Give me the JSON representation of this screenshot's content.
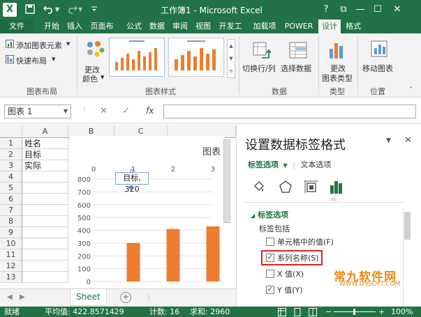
{
  "titlebar": {
    "title": "工作簿1 - Microsoft Excel",
    "app_icon": "X",
    "help": "?",
    "restore": "⧉",
    "minimize": "—",
    "maximize": "☐",
    "close": "✕"
  },
  "tabs": [
    "文件",
    "开始",
    "插入",
    "页面布",
    "公式",
    "数据",
    "审阅",
    "视图",
    "开发工",
    "加载项",
    "POWER",
    "设计",
    "格式"
  ],
  "ribbon": {
    "add_element": "添加图表元素",
    "quick_layout": "快速布局",
    "change_color_1": "更改",
    "change_color_2": "颜色",
    "group_layout": "图表布局",
    "group_styles": "图表样式",
    "switch_row_col": "切换行/列",
    "select_data": "选择数据",
    "group_data": "数据",
    "change_type_1": "更改",
    "change_type_2": "图表类型",
    "group_type": "类型",
    "move_chart": "移动图表",
    "group_location": "位置"
  },
  "formula_bar": {
    "name_box": "图表 1",
    "cancel": "✕",
    "enter": "✓",
    "fx": "fx"
  },
  "grid": {
    "columns": [
      "A",
      "B",
      "C"
    ],
    "rows": [
      "1",
      "2",
      "3",
      "4",
      "5",
      "6",
      "7",
      "8",
      "9",
      "10",
      "11",
      "12",
      "13"
    ],
    "cells": [
      "姓名",
      "目标",
      "实际"
    ]
  },
  "chart_data": {
    "type": "bar",
    "title": "图表",
    "x_ticks": [
      "0",
      "1",
      "2",
      "3"
    ],
    "y_ticks": [
      "800",
      "700",
      "600",
      "500",
      "400",
      "300",
      "200",
      "100",
      "0"
    ],
    "values": [
      300,
      410,
      430
    ],
    "ylim": [
      0,
      800
    ],
    "xlim": [
      0,
      3
    ],
    "bar_color": "#ed7d31",
    "selected_label": "目标, 320"
  },
  "sheet": {
    "tab": "Sheet",
    "nav_prev": "◀",
    "nav_next": "▶",
    "add": "+"
  },
  "pane": {
    "title": "设置数据标签格式",
    "close": "✕",
    "dropdown": "▼",
    "tab_label_options": "标签选项",
    "tab_text_options": "文本选项",
    "section": "标签选项",
    "label_contains": "标签包括",
    "options": [
      {
        "label": "单元格中的值(F)",
        "checked": false
      },
      {
        "label": "系列名称(S)",
        "checked": true
      },
      {
        "label": "X 值(X)",
        "checked": false
      },
      {
        "label": "Y 值(Y)",
        "checked": true
      }
    ],
    "check_mark": "✓"
  },
  "watermark": {
    "line1": "常九软件网",
    "line2": "WWW.D9SOFT.COM"
  },
  "status": {
    "ready": "就绪",
    "average": "平均值: 422.8571429",
    "count": "计数: 16",
    "sum": "求和: 2960",
    "zoom": "100%",
    "zoom_minus": "−",
    "zoom_plus": "+"
  },
  "colors": {
    "excel_green": "#217346",
    "bar_orange": "#ed7d31",
    "highlight_red": "#dd2222"
  }
}
